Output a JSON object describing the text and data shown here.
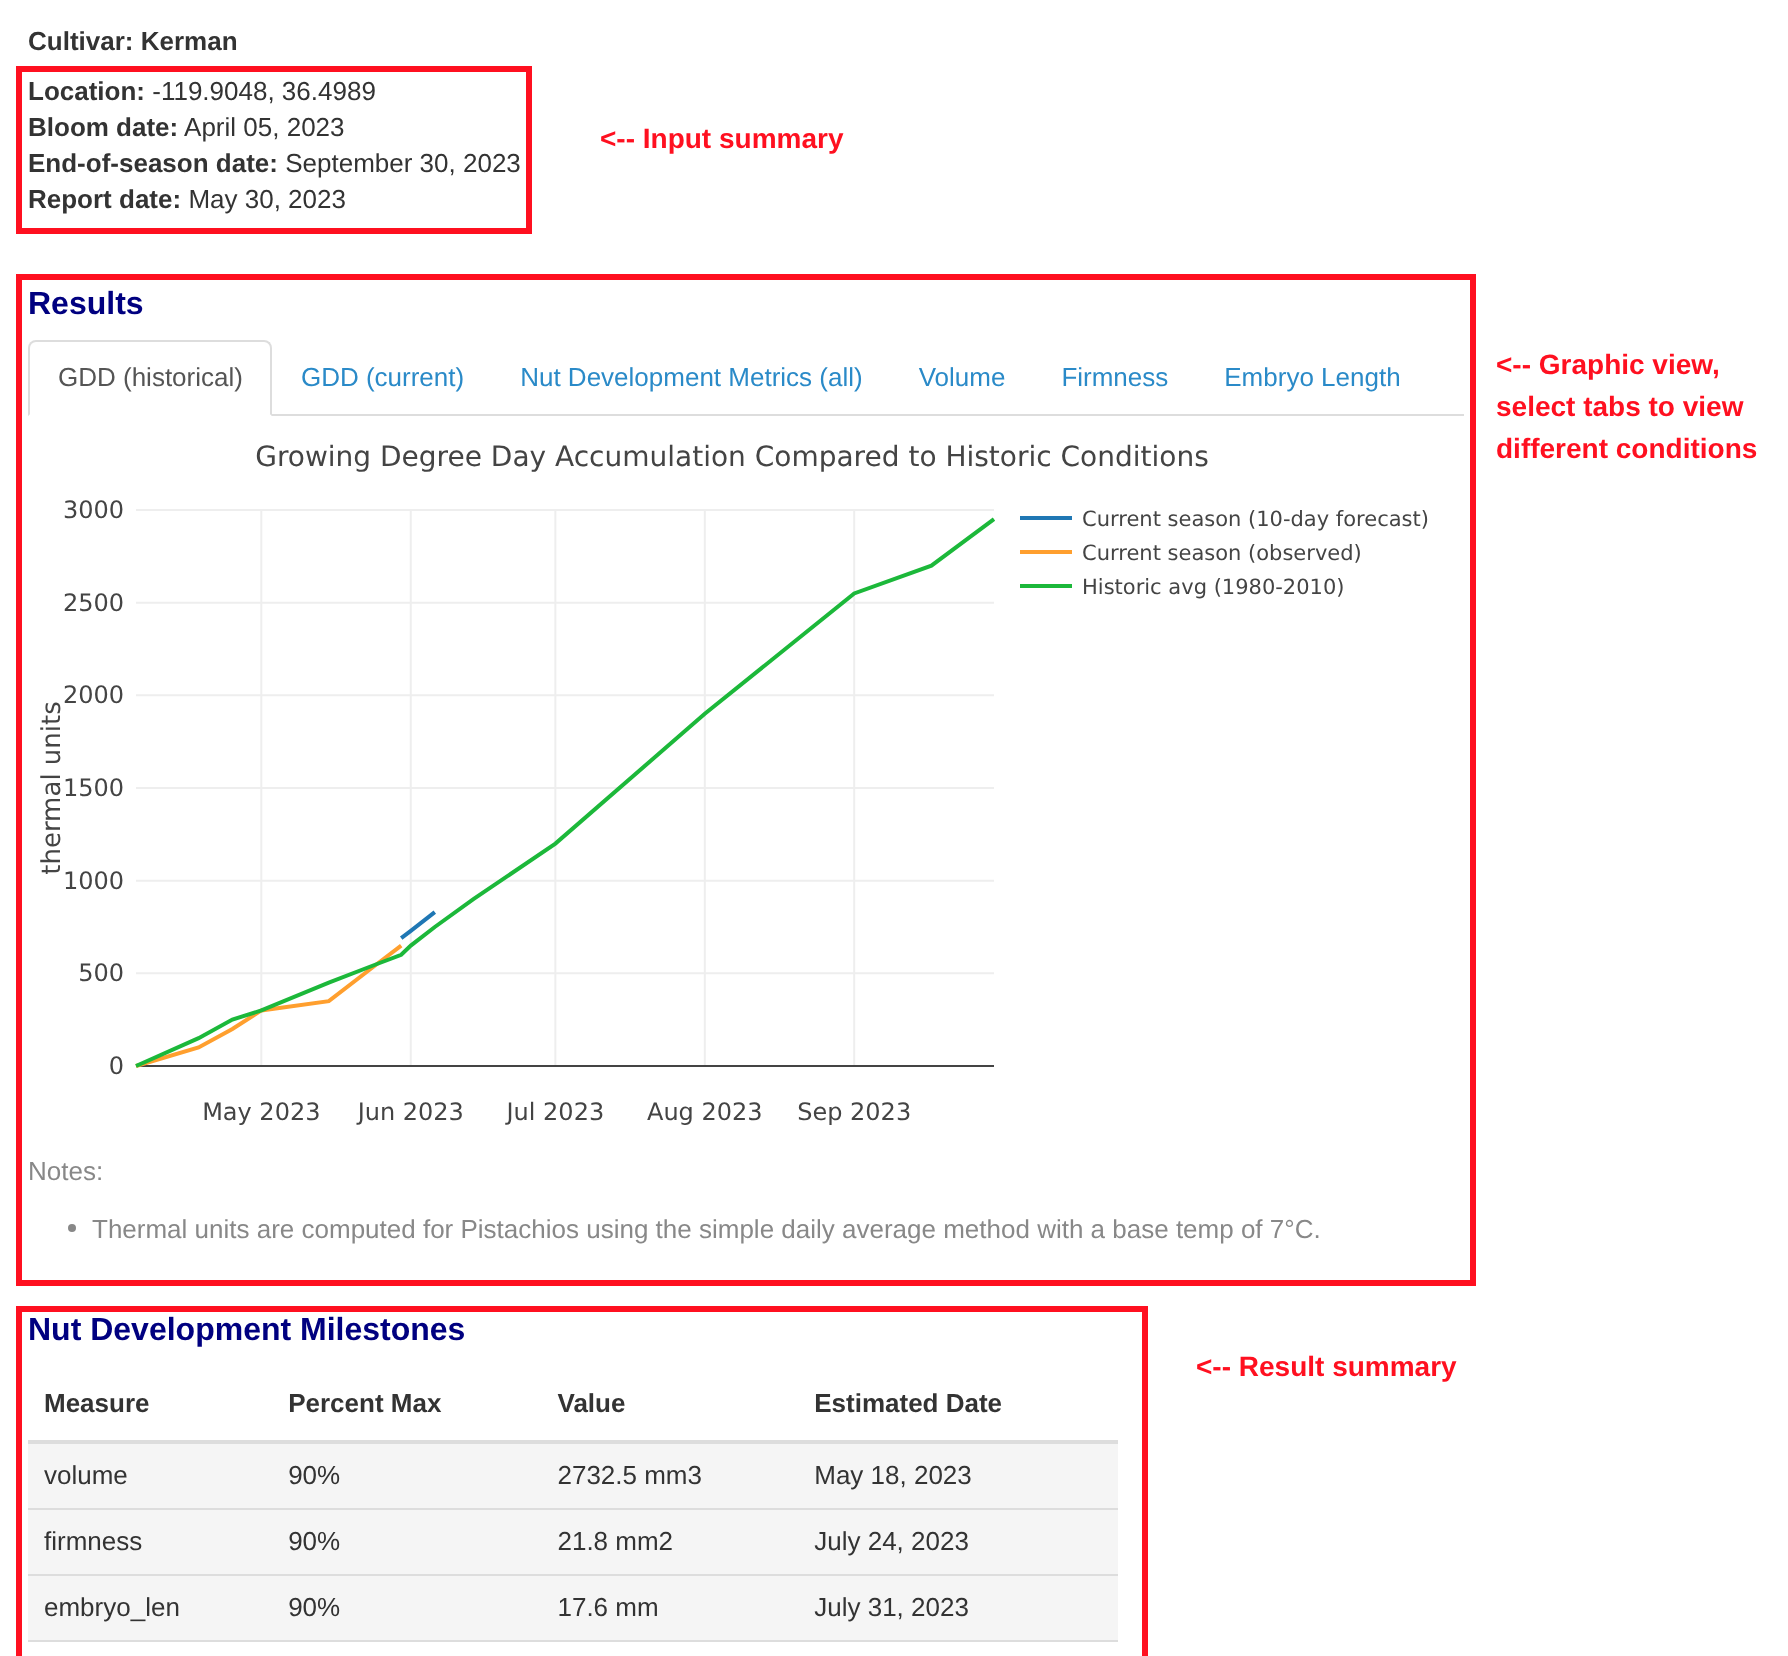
{
  "cultivar": {
    "label": "Cultivar:",
    "value": "Kerman"
  },
  "input_summary": {
    "fields": [
      {
        "label": "Location:",
        "value": "-119.9048, 36.4989"
      },
      {
        "label": "Bloom date:",
        "value": "April 05, 2023"
      },
      {
        "label": "End-of-season date:",
        "value": "September 30, 2023"
      },
      {
        "label": "Report date:",
        "value": "May 30, 2023"
      }
    ],
    "annotation": "<-- Input summary"
  },
  "results": {
    "title": "Results",
    "tabs": [
      {
        "label": "GDD (historical)",
        "selected": true
      },
      {
        "label": "GDD (current)",
        "selected": false
      },
      {
        "label": "Nut Development Metrics (all)",
        "selected": false
      },
      {
        "label": "Volume",
        "selected": false
      },
      {
        "label": "Firmness",
        "selected": false
      },
      {
        "label": "Embryo Length",
        "selected": false
      }
    ],
    "annotation": [
      "<-- Graphic view,",
      "select tabs to view",
      "different conditions"
    ],
    "chart_data": {
      "type": "line",
      "title": "Growing Degree Day Accumulation Compared to Historic Conditions",
      "ylabel": "thermal units",
      "x": [
        "2023-04-05",
        "2023-04-18",
        "2023-04-25",
        "2023-05-01",
        "2023-05-15",
        "2023-05-25",
        "2023-05-30",
        "2023-06-01",
        "2023-06-06",
        "2023-06-14",
        "2023-07-01",
        "2023-08-01",
        "2023-09-01",
        "2023-09-17",
        "2023-09-30"
      ],
      "series": [
        {
          "name": "Current season (10-day forecast)",
          "color": "#1f77b4",
          "values": [
            null,
            null,
            null,
            null,
            null,
            null,
            690,
            730,
            830,
            null,
            null,
            null,
            null,
            null,
            null
          ]
        },
        {
          "name": "Current season (observed)",
          "color": "#ff9f2e",
          "values": [
            0,
            100,
            200,
            300,
            350,
            550,
            650,
            null,
            null,
            null,
            null,
            null,
            null,
            null,
            null
          ]
        },
        {
          "name": "Historic avg (1980-2010)",
          "color": "#1cb83a",
          "values": [
            0,
            150,
            250,
            300,
            450,
            550,
            600,
            650,
            750,
            900,
            1200,
            1900,
            2550,
            2700,
            2950
          ]
        }
      ],
      "xlim": [
        "2023-04-05",
        "2023-09-30"
      ],
      "ylim": [
        0,
        3000
      ],
      "xticks": [
        {
          "value": "2023-05-01",
          "label": "May 2023"
        },
        {
          "value": "2023-06-01",
          "label": "Jun 2023"
        },
        {
          "value": "2023-07-01",
          "label": "Jul 2023"
        },
        {
          "value": "2023-08-01",
          "label": "Aug 2023"
        },
        {
          "value": "2023-09-01",
          "label": "Sep 2023"
        }
      ],
      "yticks": [
        0,
        500,
        1000,
        1500,
        2000,
        2500,
        3000
      ],
      "grid": true,
      "legend": true
    },
    "notes_label": "Notes:",
    "notes": [
      "Thermal units are computed for Pistachios using the simple daily average method with a base temp of 7°C."
    ]
  },
  "milestones": {
    "title": "Nut Development Milestones",
    "columns": [
      "Measure",
      "Percent Max",
      "Value",
      "Estimated Date"
    ],
    "rows": [
      [
        "volume",
        "90%",
        "2732.5 mm3",
        "May 18, 2023"
      ],
      [
        "firmness",
        "90%",
        "21.8 mm2",
        "July 24, 2023"
      ],
      [
        "embryo_len",
        "90%",
        "17.6 mm",
        "July 31, 2023"
      ]
    ],
    "annotation": "<-- Result summary"
  }
}
